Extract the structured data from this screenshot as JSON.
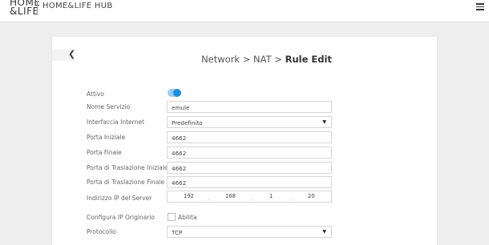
{
  "header": {
    "logo_line1": "HOME",
    "logo_line2": "&LIFE",
    "hub_title": "HOME&LIFE HUB",
    "menu_icon": "hamburger-icon"
  },
  "nav": {
    "back_icon": "chevron-left-icon",
    "breadcrumb_prefix": "Network > NAT > ",
    "breadcrumb_current": "Rule Edit"
  },
  "form": {
    "active": {
      "label": "Attivo",
      "value": true
    },
    "service_name": {
      "label": "Nome Servizio",
      "value": "emule"
    },
    "internet_interface": {
      "label": "Interfaccia Internet",
      "value": "Predefinito"
    },
    "start_port": {
      "label": "Porta Iniziale",
      "value": "4662"
    },
    "end_port": {
      "label": "Porta Finale",
      "value": "4662"
    },
    "translation_start_port": {
      "label": "Porta di Traslazione Iniziale",
      "value": "4662"
    },
    "translation_end_port": {
      "label": "Porta di Traslazione Finale",
      "value": "4662"
    },
    "server_ip": {
      "label": "Indirizzo IP del Server",
      "octets": [
        "192",
        "168",
        "1",
        "20"
      ]
    },
    "original_ip": {
      "label": "Configura IP Originario",
      "checkbox_label": "Abilita",
      "checked": false
    },
    "protocol": {
      "label": "Protocollo",
      "value": "TCP"
    }
  },
  "colors": {
    "accent": "#1a8fe0",
    "background": "#eeeeee"
  }
}
